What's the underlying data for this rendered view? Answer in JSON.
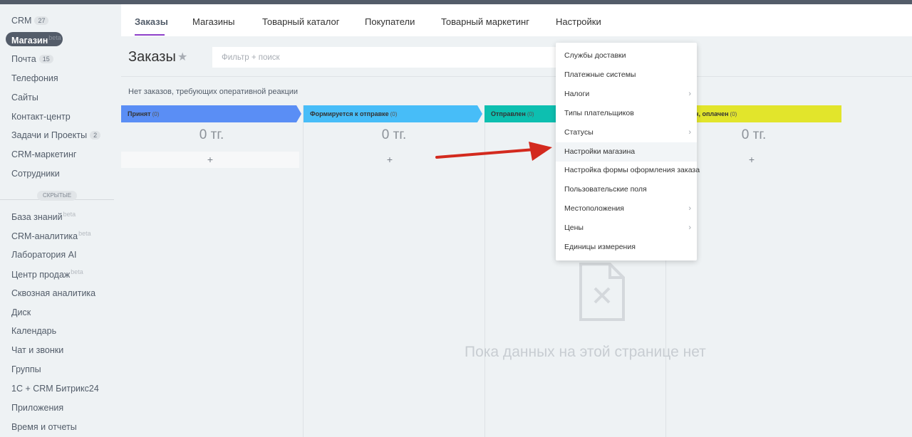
{
  "sidebar": {
    "crm": {
      "label": "CRM",
      "count": "27"
    },
    "shop": {
      "label": "Магазин",
      "beta": "beta"
    },
    "mail": {
      "label": "Почта",
      "count": "15"
    },
    "telephony": "Телефония",
    "sites": "Сайты",
    "contact_center": "Контакт-центр",
    "tasks": {
      "label": "Задачи и Проекты",
      "count": "2"
    },
    "crm_marketing": "CRM-маркетинг",
    "employees": "Сотрудники",
    "hidden_label": "СКРЫТЫЕ",
    "knowledge": {
      "label": "База знаний",
      "beta": "beta"
    },
    "crm_analytics": {
      "label": "CRM-аналитика",
      "beta": "beta"
    },
    "ai_lab": "Лаборатория AI",
    "sales_center": {
      "label": "Центр продаж",
      "beta": "beta"
    },
    "end_to_end": "Сквозная аналитика",
    "disk": "Диск",
    "calendar": "Календарь",
    "chat": "Чат и звонки",
    "groups": "Группы",
    "onec": "1С + CRM Битрикс24",
    "apps": "Приложения",
    "time": "Время и отчеты"
  },
  "tabs": [
    "Заказы",
    "Магазины",
    "Товарный каталог",
    "Покупатели",
    "Товарный маркетинг",
    "Настройки"
  ],
  "page": {
    "title": "Заказы",
    "star": "★",
    "filter_placeholder": "Фильтр + поиск",
    "notice": "Нет заказов, требующих оперативной реакции",
    "empty_text": "Пока данных на этой странице нет"
  },
  "stages": [
    {
      "name": "Принят",
      "count": "(0)",
      "color": "#5a8ef5",
      "sum": "0 тг."
    },
    {
      "name": "Формируется к отправке",
      "count": "(0)",
      "color": "#47bdf8",
      "sum": "0 тг."
    },
    {
      "name": "Отправлен",
      "count": "(0)",
      "color": "#0dbfb0",
      "sum": ""
    },
    {
      "name": "ен, оплачен",
      "count": "(0)",
      "color": "#e2e52b",
      "sum": "0 тг."
    }
  ],
  "add_label": "+",
  "menu": {
    "items": [
      {
        "label": "Службы доставки",
        "arrow": ""
      },
      {
        "label": "Платежные системы",
        "arrow": ""
      },
      {
        "label": "Налоги",
        "arrow": "›"
      },
      {
        "label": "Типы плательщиков",
        "arrow": ""
      },
      {
        "label": "Статусы",
        "arrow": "›"
      },
      {
        "label": "Настройки магазина",
        "arrow": ""
      },
      {
        "label": "Настройка формы оформления заказа",
        "arrow": ""
      },
      {
        "label": "Пользовательские поля",
        "arrow": ""
      },
      {
        "label": "Местоположения",
        "arrow": "›"
      },
      {
        "label": "Цены",
        "arrow": "›"
      },
      {
        "label": "Единицы измерения",
        "arrow": ""
      }
    ]
  },
  "colors": {
    "accent": "#8d40c9",
    "arrow": "#d32a1e"
  }
}
